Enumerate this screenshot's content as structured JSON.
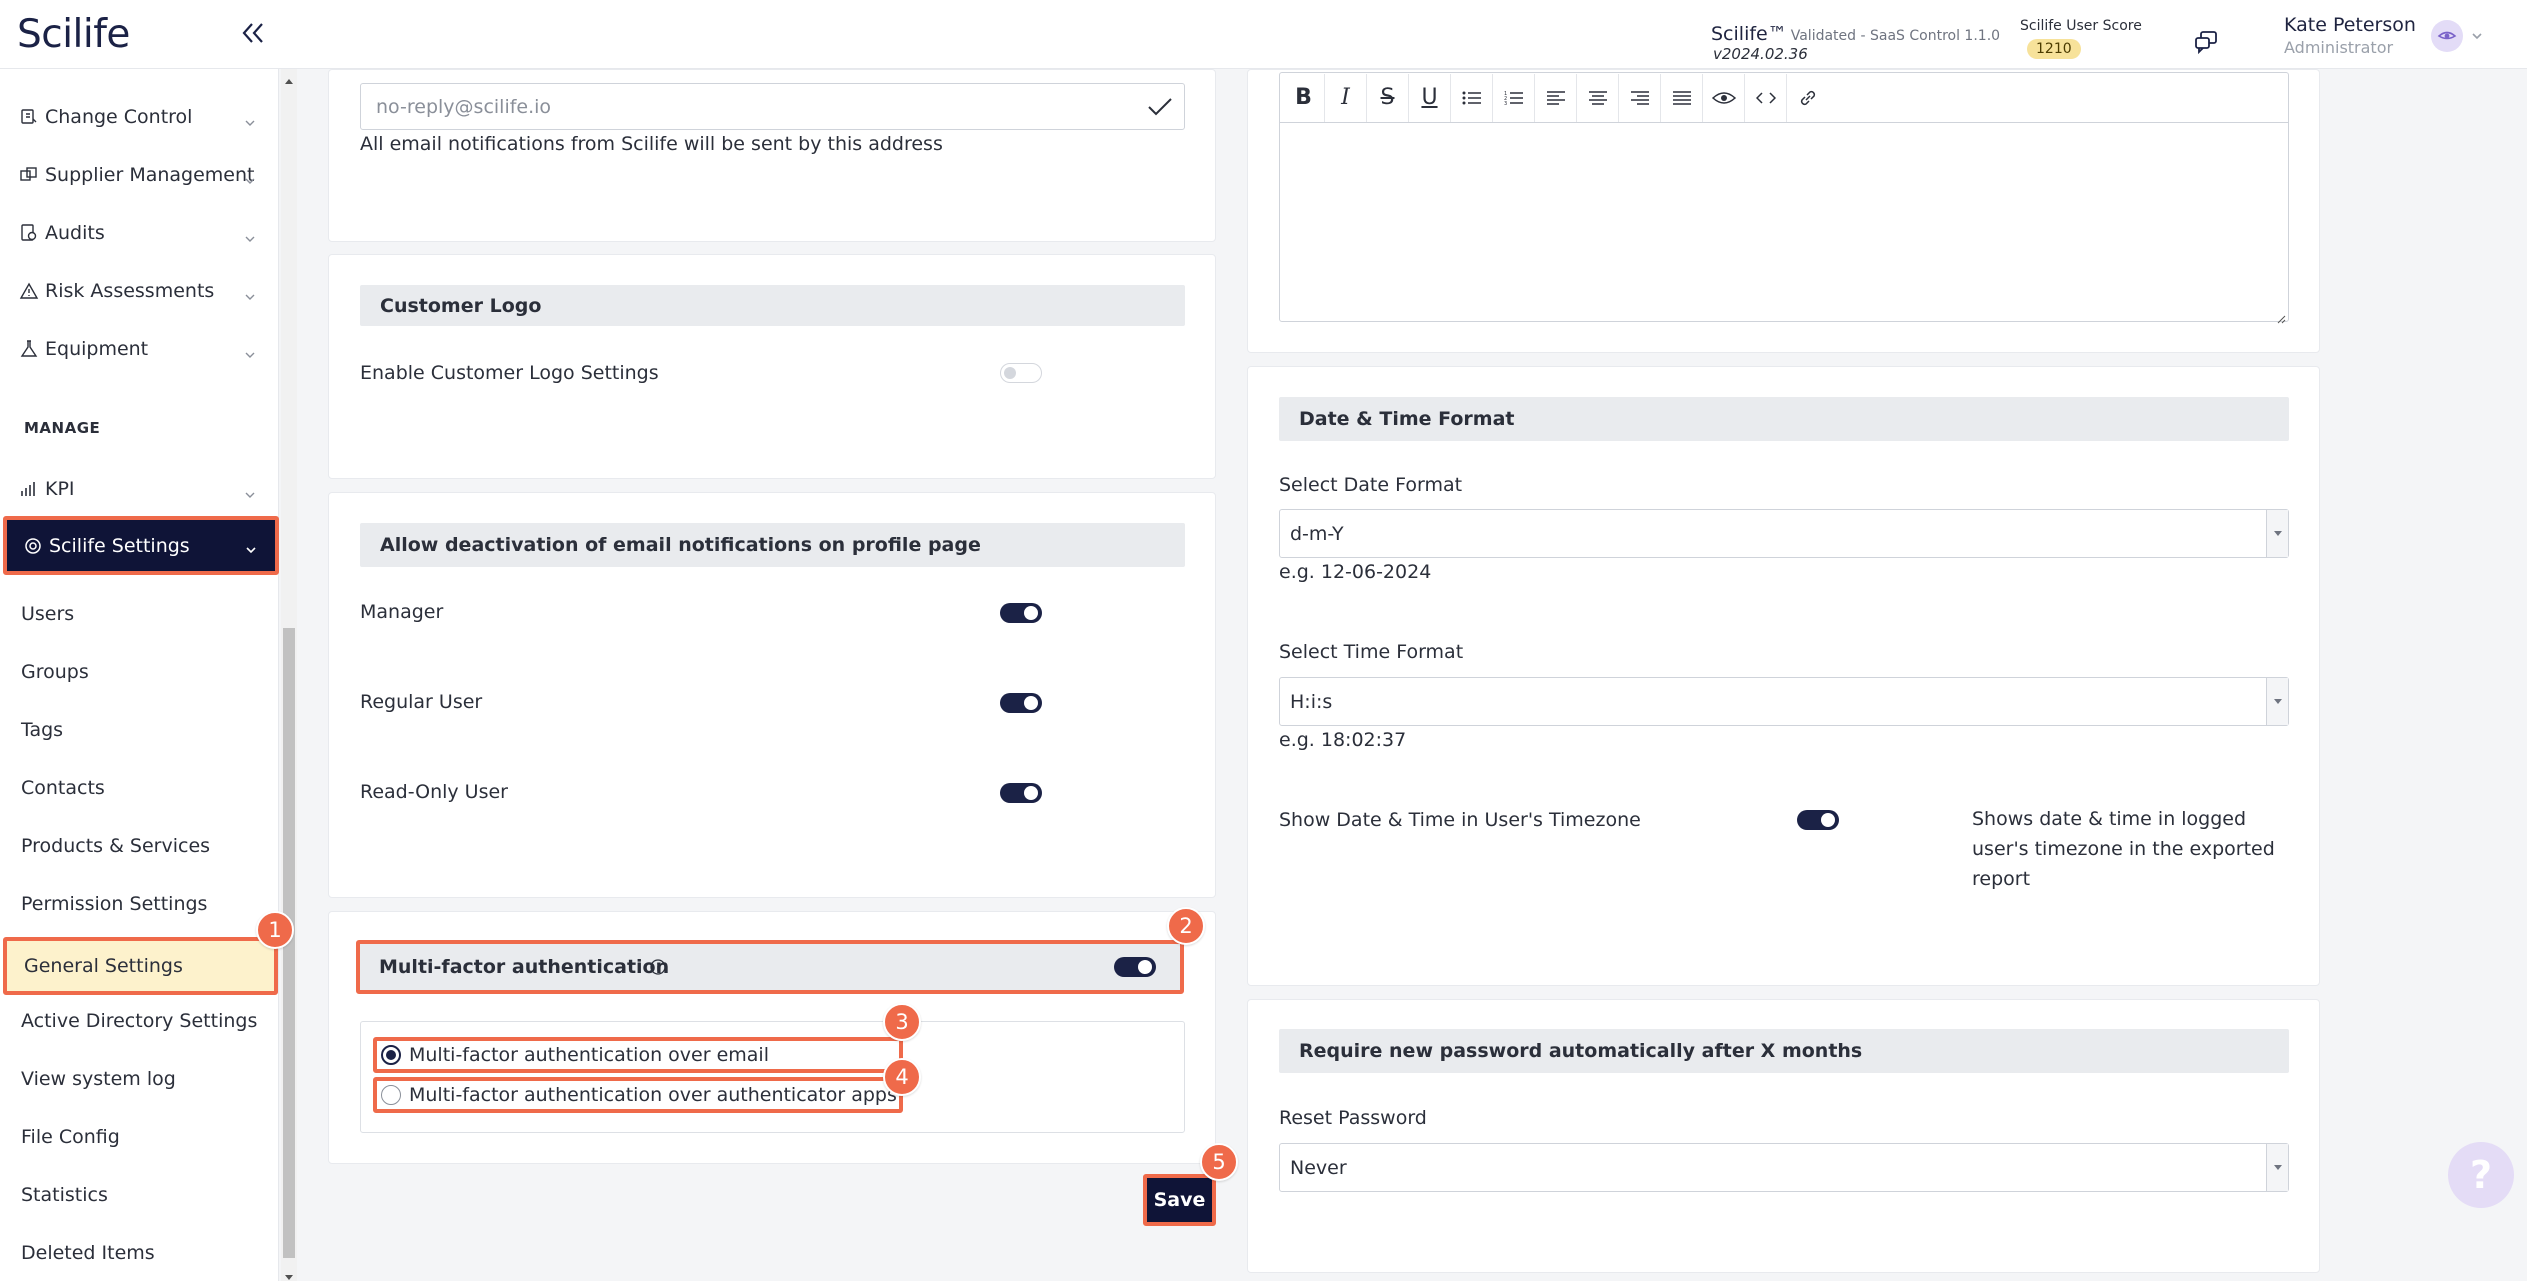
{
  "header": {
    "logo": "Scilife",
    "brand_name": "Scilife™",
    "brand_validated": "Validated - SaaS Control 1.1.0",
    "version": "v2024.02.36",
    "score_label": "Scilife User Score",
    "score_value": "1210",
    "user_name": "Kate Peterson",
    "user_role": "Administrator"
  },
  "sidebar": {
    "top_items": [
      {
        "label": "Change Control",
        "icon": "change-control-icon"
      },
      {
        "label": "Supplier Management",
        "icon": "supplier-icon"
      },
      {
        "label": "Audits",
        "icon": "audits-icon"
      },
      {
        "label": "Risk Assessments",
        "icon": "warning-icon"
      },
      {
        "label": "Equipment",
        "icon": "flask-icon"
      }
    ],
    "section_manage": "MANAGE",
    "kpi": "KPI",
    "active_item": "Scilife Settings",
    "sub_items": [
      "Users",
      "Groups",
      "Tags",
      "Contacts",
      "Products & Services",
      "Permission Settings",
      "General Settings",
      "Active Directory Settings",
      "View system log",
      "File Config",
      "Statistics",
      "Deleted Items"
    ]
  },
  "email_section": {
    "sender_value": "no-reply@scilife.io",
    "sender_hint": "All email notifications from Scilife will be sent by this address"
  },
  "customer_logo": {
    "title": "Customer Logo",
    "enable_label": "Enable Customer Logo Settings",
    "enabled": false
  },
  "email_deactivation": {
    "title": "Allow deactivation of email notifications on profile page",
    "roles": [
      {
        "label": "Manager",
        "enabled": true
      },
      {
        "label": "Regular User",
        "enabled": true
      },
      {
        "label": "Read-Only User",
        "enabled": true
      }
    ]
  },
  "mfa": {
    "title": "Multi-factor authentication",
    "enabled": true,
    "option_email": "Multi-factor authentication over email",
    "option_apps": "Multi-factor authentication over authenticator apps",
    "selected": "email"
  },
  "save_label": "Save",
  "date_time": {
    "title": "Date & Time Format",
    "date_label": "Select Date Format",
    "date_value": "d-m-Y",
    "date_example": "e.g. 12-06-2024",
    "time_label": "Select Time Format",
    "time_value": "H:i:s",
    "time_example": "e.g. 18:02:37",
    "timezone_label": "Show Date & Time in User's Timezone",
    "timezone_enabled": true,
    "timezone_hint_1": "Shows date & time in logged",
    "timezone_hint_2": "user's timezone in the exported",
    "timezone_hint_3": "report"
  },
  "password": {
    "title": "Require new password automatically after X months",
    "reset_label": "Reset Password",
    "reset_value": "Never"
  },
  "steps": [
    "1",
    "2",
    "3",
    "4",
    "5"
  ],
  "colors": {
    "accent": "#ef6a4a",
    "navy": "#0f1437",
    "highlight": "#fdf2cc"
  }
}
